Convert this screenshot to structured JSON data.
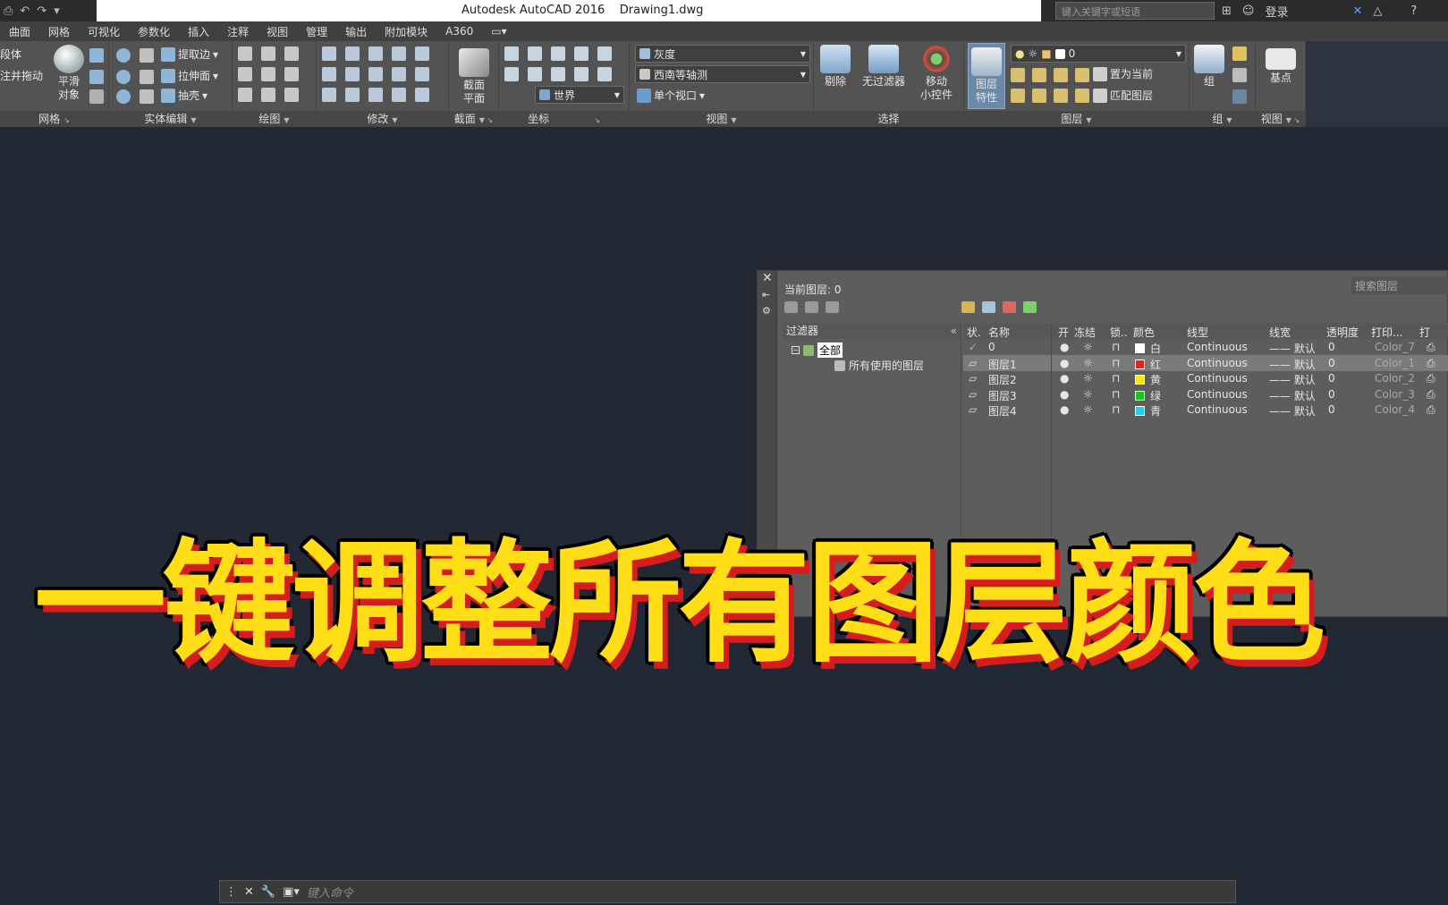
{
  "titlebar": {
    "title": "Autodesk AutoCAD 2016    Drawing1.dwg",
    "search_placeholder": "键入关键字或短语",
    "login": "登录"
  },
  "menu": {
    "tabs": [
      "曲面",
      "网格",
      "可视化",
      "参数化",
      "插入",
      "注释",
      "视图",
      "管理",
      "输出",
      "附加模块",
      "A360"
    ]
  },
  "ribbon": {
    "mesh": {
      "label1": "段体",
      "label2": "注并拖动",
      "smooth_label": "平滑\n对象",
      "title": "网格"
    },
    "solid_edit": {
      "extract_edges": "提取边",
      "extrude_faces": "拉伸面",
      "shell": "抽壳",
      "title": "实体编辑"
    },
    "draw": {
      "title": "绘图"
    },
    "modify": {
      "title": "修改"
    },
    "section": {
      "plane_label": "截面\n平面",
      "title": "截面"
    },
    "coords": {
      "world": "世界",
      "title": "坐标"
    },
    "view": {
      "visual_style": "灰度",
      "view_name": "西南等轴测",
      "viewport": "单个视口",
      "title": "视图"
    },
    "select": {
      "cull": "剔除",
      "no_filter": "无过滤器",
      "gizmo": "移动\n小控件",
      "title": "选择"
    },
    "layers": {
      "props": "图层\n特性",
      "current_layer": "0",
      "set_current": "置为当前",
      "match_layer": "匹配图层",
      "title": "图层"
    },
    "group": {
      "group_label": "组",
      "title": "组"
    },
    "view2": {
      "basepoint": "基点",
      "title": "视图"
    }
  },
  "layer_dialog": {
    "current_layer": "当前图层: 0",
    "search_placeholder": "搜索图层",
    "filters_header": "过滤器",
    "filter_all": "全部",
    "filter_used": "所有使用的图层",
    "columns": [
      "状.",
      "名称",
      "开",
      "冻结",
      "锁..",
      "颜色",
      "线型",
      "线宽",
      "透明度",
      "打印...",
      "打"
    ],
    "rows": [
      {
        "name": "0",
        "color_name": "白",
        "color_hex": "#ffffff",
        "linetype": "Continuous",
        "lineweight": "默认",
        "transparency": "0",
        "plot_style": "Color_7",
        "status": "current"
      },
      {
        "name": "图层1",
        "color_name": "红",
        "color_hex": "#e52222",
        "linetype": "Continuous",
        "lineweight": "默认",
        "transparency": "0",
        "plot_style": "Color_1",
        "status": "layer"
      },
      {
        "name": "图层2",
        "color_name": "黄",
        "color_hex": "#f2e617",
        "linetype": "Continuous",
        "lineweight": "默认",
        "transparency": "0",
        "plot_style": "Color_2",
        "status": "layer"
      },
      {
        "name": "图层3",
        "color_name": "绿",
        "color_hex": "#1fc31f",
        "linetype": "Continuous",
        "lineweight": "默认",
        "transparency": "0",
        "plot_style": "Color_3",
        "status": "layer"
      },
      {
        "name": "图层4",
        "color_name": "青",
        "color_hex": "#1fd0e8",
        "linetype": "Continuous",
        "lineweight": "默认",
        "transparency": "0",
        "plot_style": "Color_4",
        "status": "layer"
      }
    ]
  },
  "banner": {
    "text": "一键调整所有图层颜色"
  },
  "command_line": {
    "placeholder": "键入命令"
  },
  "colors": {
    "banner_fill": "#ffde17",
    "banner_shadow": "#d61d1d",
    "background": "#222834"
  }
}
